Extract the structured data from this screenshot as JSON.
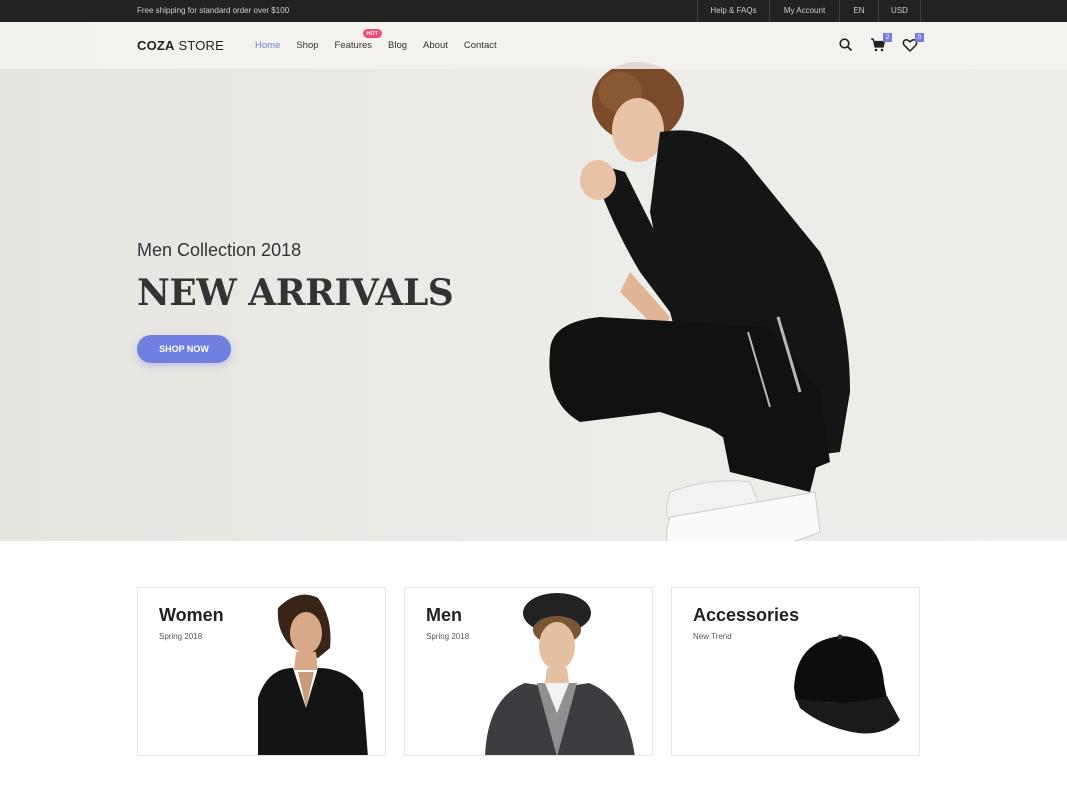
{
  "topbar": {
    "shipping": "Free shipping for standard order over $100",
    "links": [
      "Help & FAQs",
      "My Account",
      "EN",
      "USD"
    ]
  },
  "header": {
    "logo_bold": "COZA",
    "logo_light": " STORE",
    "nav": [
      "Home",
      "Shop",
      "Features",
      "Blog",
      "About",
      "Contact"
    ],
    "active_nav": "Home",
    "hot_badge": "HOT",
    "cart_count": "2",
    "wishlist_count": "0"
  },
  "hero": {
    "subtitle": "Men Collection 2018",
    "title": "NEW ARRIVALS",
    "button": "SHOP NOW"
  },
  "categories": [
    {
      "name": "Women",
      "sub": "Spring 2018"
    },
    {
      "name": "Men",
      "sub": "Spring 2018"
    },
    {
      "name": "Accessories",
      "sub": "New Trend"
    }
  ],
  "colors": {
    "accent": "#717fe0",
    "hot": "#f74877",
    "topbar": "#222222"
  },
  "icons": [
    "search-icon",
    "cart-icon",
    "heart-icon"
  ]
}
